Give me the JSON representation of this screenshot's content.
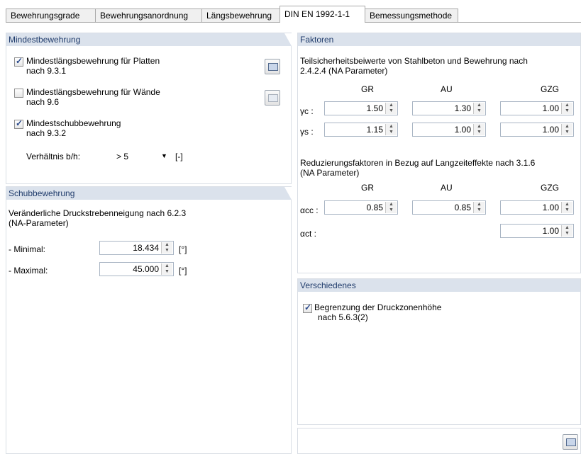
{
  "tabs": [
    "Bewehrungsgrade",
    "Bewehrungsanordnung",
    "Längsbewehrung",
    "DIN EN 1992-1-1",
    "Bemessungsmethode"
  ],
  "left_top": {
    "title": "Mindestbewehrung",
    "cb1": {
      "line1": "Mindestlängsbewehrung für Platten",
      "line2": "nach 9.3.1",
      "checked": true
    },
    "cb2": {
      "line1": "Mindestlängsbewehrung für Wände",
      "line2": "nach 9.6",
      "checked": false
    },
    "cb3": {
      "line1": "Mindestschubbewehrung",
      "line2": "nach 9.3.2",
      "checked": true
    },
    "ratio_label": "Verhältnis b/h:",
    "ratio_value": "> 5",
    "ratio_unit": "[-]",
    "check_mark": "✓"
  },
  "left_bottom": {
    "title": "Schubbewehrung",
    "desc1": "Veränderliche Druckstrebenneigung nach 6.2.3",
    "desc2": "(NA-Parameter)",
    "min_label": "- Minimal:",
    "min_value": "18.434",
    "max_label": "- Maximal:",
    "max_value": "45.000",
    "unit": "[°]"
  },
  "right_top": {
    "title": "Faktoren",
    "desc1": "Teilsicherheitsbeiwerte von Stahlbeton und Bewehrung nach",
    "desc2": "2.4.2.4 (NA Parameter)",
    "cols": [
      "GR",
      "AU",
      "GZG"
    ],
    "gamma_c_label": "γc :",
    "gamma_c": [
      "1.50",
      "1.30",
      "1.00"
    ],
    "gamma_s_label": "γs :",
    "gamma_s": [
      "1.15",
      "1.00",
      "1.00"
    ],
    "red1": "Reduzierungsfaktoren in Bezug auf Langzeiteffekte nach 3.1.6",
    "red2": "(NA Parameter)",
    "cols2": [
      "GR",
      "AU",
      "GZG"
    ],
    "alpha_cc_label": "αcc :",
    "alpha_cc": [
      "0.85",
      "0.85",
      "1.00"
    ],
    "alpha_ct_label": "αct :",
    "alpha_ct": "1.00"
  },
  "right_mid": {
    "title": "Verschiedenes",
    "cb_line1": "Begrenzung der Druckzonenhöhe",
    "cb_line2": "nach 5.6.3(2)",
    "checked": true
  },
  "spin_up": "▲",
  "spin_down": "▼",
  "combo_arrow": "▼"
}
